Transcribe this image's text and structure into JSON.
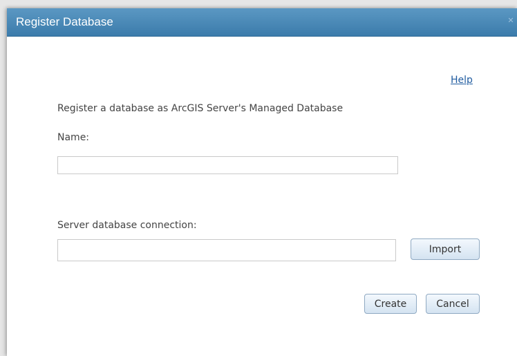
{
  "dialog": {
    "title": "Register Database",
    "close_icon": "close-icon",
    "close_glyph": "✕"
  },
  "help": {
    "label": "Help"
  },
  "form": {
    "description": "Register a database as ArcGIS Server's Managed Database",
    "name_label": "Name:",
    "name_value": "",
    "connection_label": "Server database connection:",
    "connection_value": ""
  },
  "buttons": {
    "import_label": "Import",
    "create_label": "Create",
    "cancel_label": "Cancel"
  },
  "colors": {
    "titlebar": "#4a8aba",
    "title_text": "#ffffff",
    "link": "#1f5b9f",
    "body_text": "#444444",
    "button_border": "#8fa9c2"
  }
}
